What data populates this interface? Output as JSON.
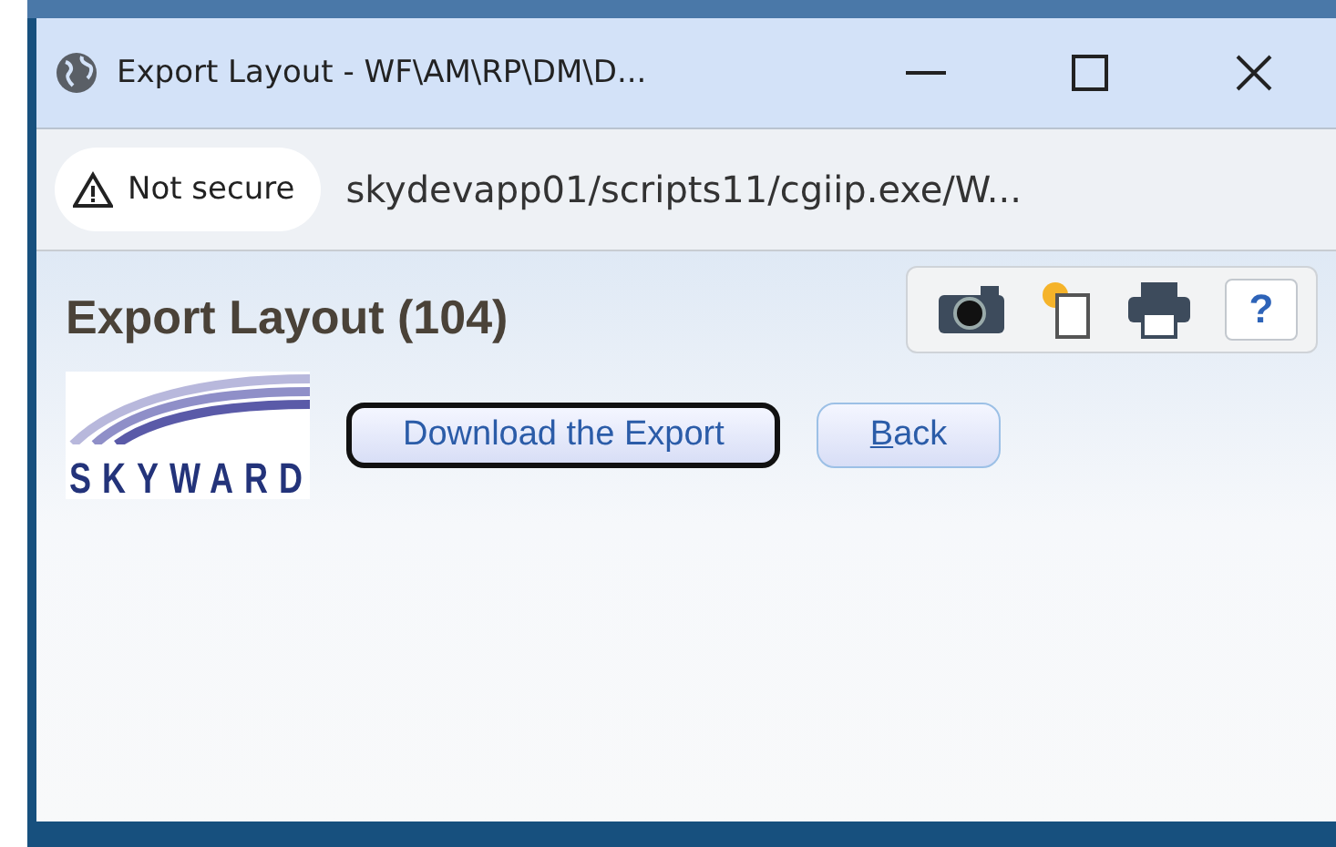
{
  "window": {
    "title": "Export Layout - WF\\AM\\RP\\DM\\D..."
  },
  "address_bar": {
    "security": "Not secure",
    "url": "skydevapp01/scripts11/cgiip.exe/W..."
  },
  "page": {
    "heading": "Export Layout (104)",
    "logo_text": "SKYWARD",
    "toolbar": [
      {
        "kind": "camera"
      },
      {
        "kind": "new"
      },
      {
        "kind": "print"
      },
      {
        "kind": "help",
        "label": "?"
      }
    ],
    "buttons": [
      {
        "label": "Download the Export",
        "focused": true,
        "underline_first": false
      },
      {
        "label": "Back",
        "focused": false,
        "underline_first": true
      }
    ]
  }
}
